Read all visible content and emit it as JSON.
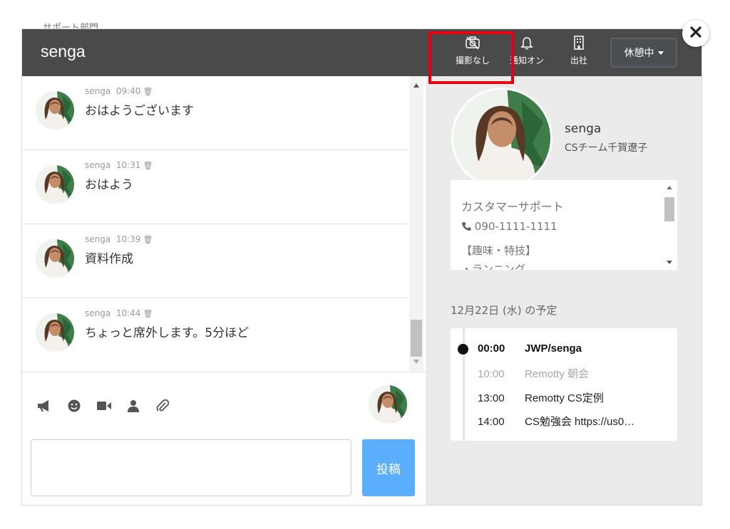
{
  "header": {
    "title": "senga",
    "buttons": [
      {
        "label": "撮影なし",
        "icon": "camera-off-icon"
      },
      {
        "label": "通知オン",
        "icon": "bell-icon"
      },
      {
        "label": "出社",
        "icon": "building-icon"
      }
    ],
    "status": "休憩中"
  },
  "messages": [
    {
      "user": "senga",
      "time": "09:40",
      "text": "おはようございます"
    },
    {
      "user": "senga",
      "time": "10:31",
      "text": "おはよう"
    },
    {
      "user": "senga",
      "time": "10:39",
      "text": "資料作成"
    },
    {
      "user": "senga",
      "time": "10:44",
      "text": "ちょっと席外します。5分ほど"
    }
  ],
  "compose": {
    "post_label": "投稿",
    "placeholder": "",
    "tools": [
      "megaphone-icon",
      "smiley-icon",
      "video-icon",
      "person-icon",
      "paperclip-icon"
    ]
  },
  "profile": {
    "name": "senga",
    "team": "CSチーム千賀遼子",
    "department": "カスタマーサポート",
    "phone": "090-1111-1111",
    "hobby_header": "【趣味・特技】",
    "hobby_item": "・ランニング"
  },
  "schedule": {
    "title": "12月22日 (水) の予定",
    "items": [
      {
        "time": "00:00",
        "title": "JWP/senga",
        "state": "active"
      },
      {
        "time": "10:00",
        "title": "Remotty 朝会",
        "state": "past"
      },
      {
        "time": "13:00",
        "title": "Remotty CS定例",
        "state": "normal"
      },
      {
        "time": "14:00",
        "title": "CS勉強会 https://us0…",
        "state": "normal"
      }
    ]
  },
  "colors": {
    "header_bg": "#4a4a4a",
    "post_button": "#5aaefb",
    "highlight": "#e60012"
  }
}
